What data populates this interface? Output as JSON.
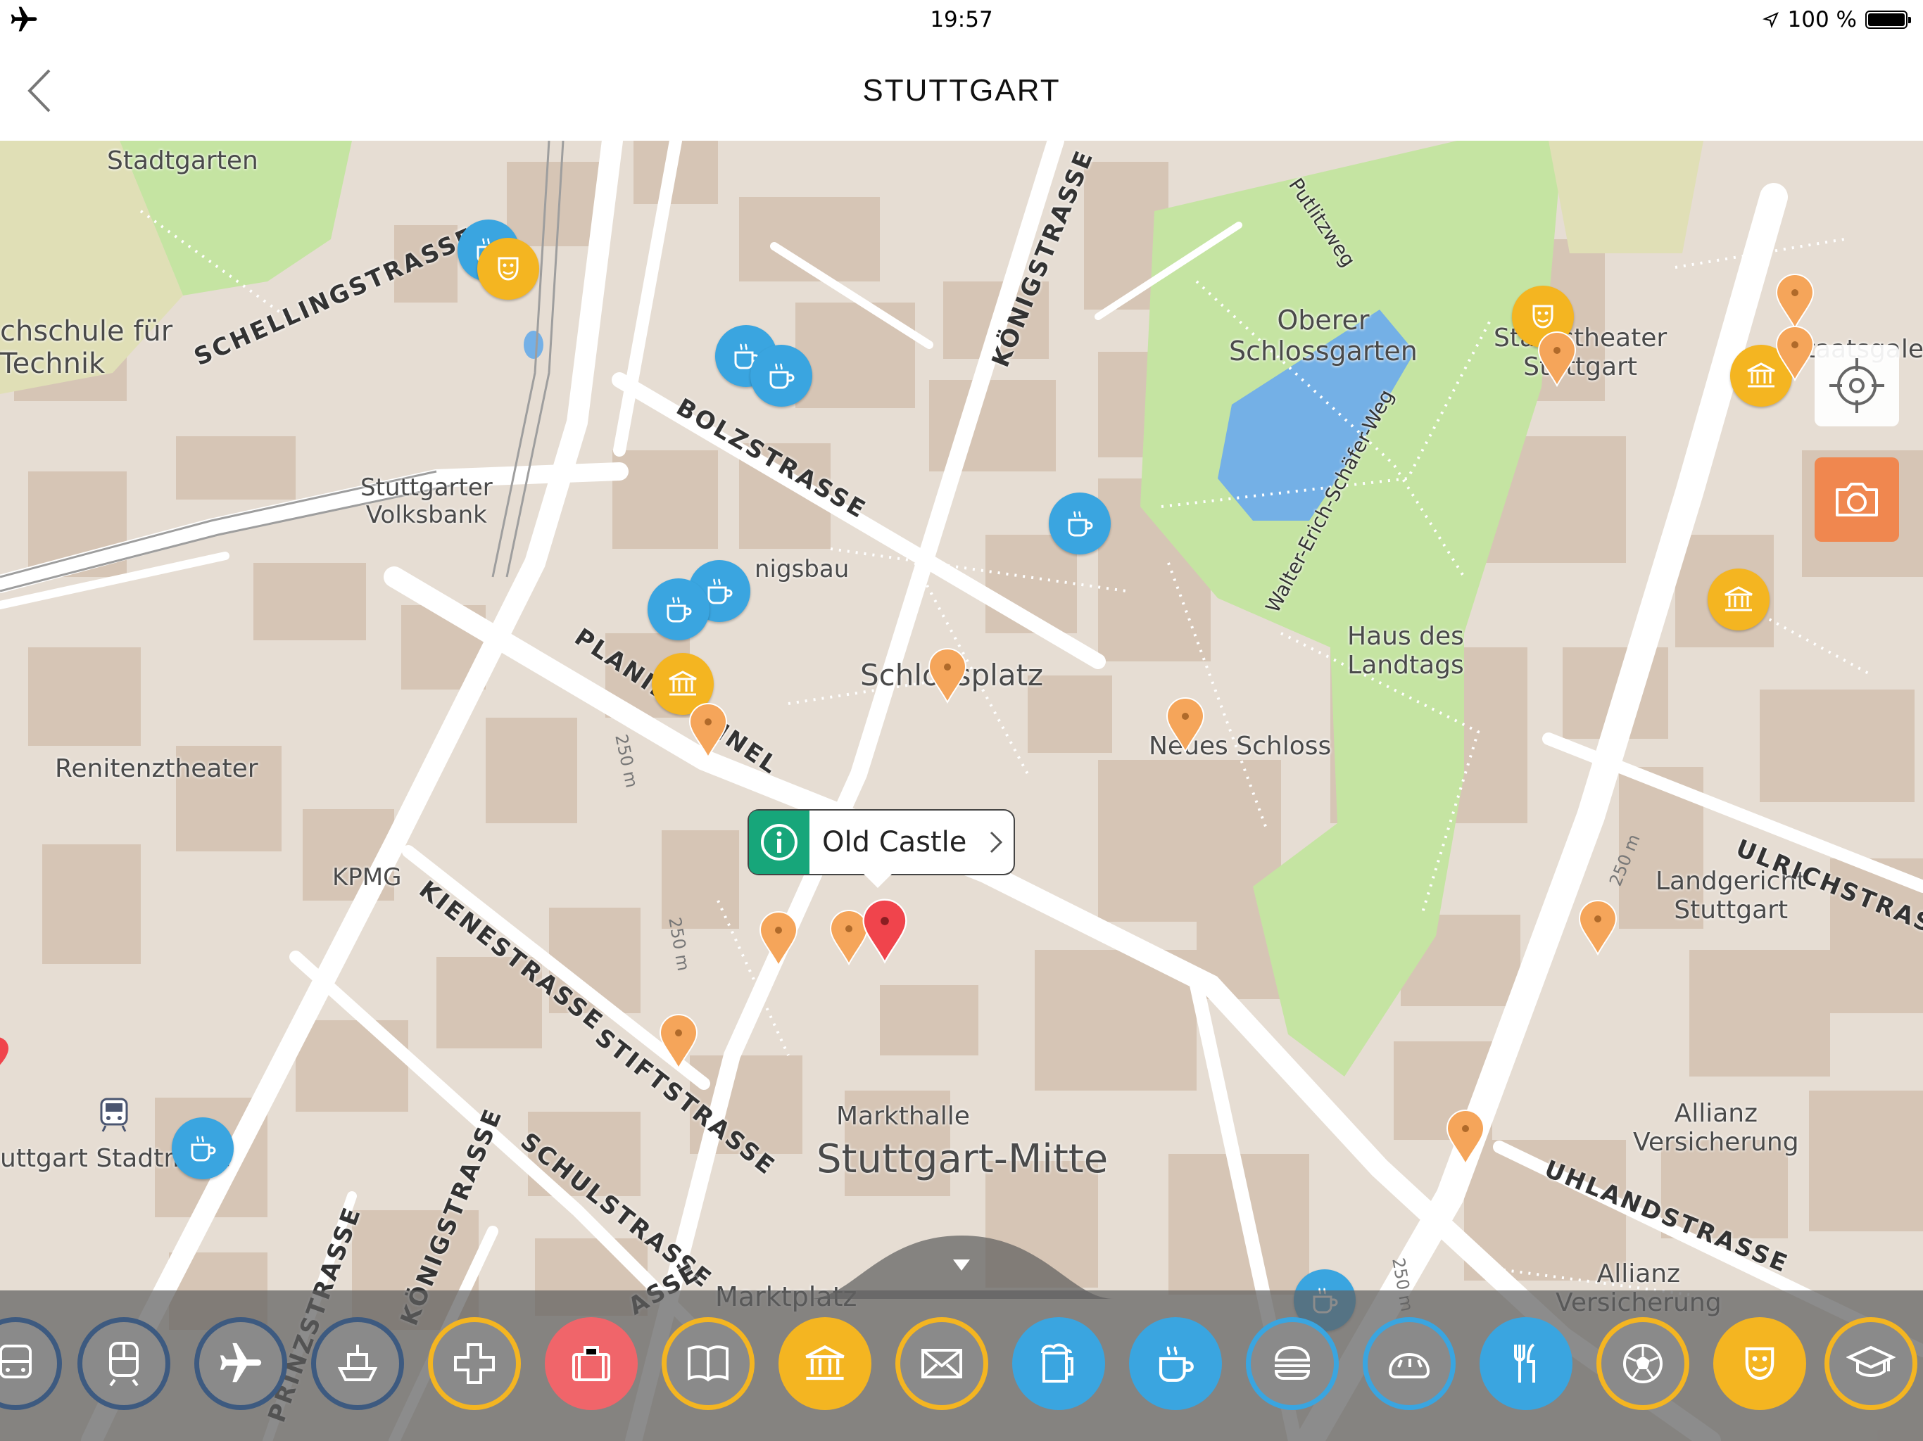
{
  "status_bar": {
    "time": "19:57",
    "battery": "100 %",
    "battery_level": 1.0
  },
  "nav": {
    "title": "STUTTGART"
  },
  "map": {
    "place_labels": [
      {
        "id": "stadtgarten",
        "text": "Stadtgarten"
      },
      {
        "id": "hochschule",
        "text": "chschule für\nTechnik"
      },
      {
        "id": "volksbank",
        "text": "Stuttgarter\nVolksbank"
      },
      {
        "id": "konigsbau",
        "text": "nigsbau"
      },
      {
        "id": "schlossplatz",
        "text": "Schlossplatz"
      },
      {
        "id": "oberer",
        "text": "Oberer\nSchlossgarten"
      },
      {
        "id": "staatstheater",
        "text": "Staatstheater\nStuttgart"
      },
      {
        "id": "staatsgalerie",
        "text": "Staatsgaleri"
      },
      {
        "id": "haus",
        "text": "Haus des\nLandtags"
      },
      {
        "id": "neues",
        "text": "Neues Schloss"
      },
      {
        "id": "renitenz",
        "text": "Renitenztheater"
      },
      {
        "id": "kpmg",
        "text": "KPMG"
      },
      {
        "id": "landgericht",
        "text": "Landgericht\nStuttgart"
      },
      {
        "id": "markthalle",
        "text": "Markthalle"
      },
      {
        "id": "mitte",
        "text": "Stuttgart-Mitte"
      },
      {
        "id": "allianz1",
        "text": "Allianz\nVersicherung"
      },
      {
        "id": "allianz2",
        "text": "Allianz\nVersicherung"
      },
      {
        "id": "marktplatz",
        "text": "Marktplatz"
      },
      {
        "id": "stadtmitte",
        "text": "uttgart Stadtmitte"
      }
    ],
    "street_labels": [
      {
        "id": "schelling",
        "text": "SCHELLINGSTRASSE"
      },
      {
        "id": "konig1",
        "text": "KÖNIGSTRASSE"
      },
      {
        "id": "bolz",
        "text": "BOLZSTRASSE"
      },
      {
        "id": "planie",
        "text": "PLANIE TUNNEL"
      },
      {
        "id": "kiene",
        "text": "KIENESTRASSE"
      },
      {
        "id": "stift",
        "text": "STIFTSTRASSE"
      },
      {
        "id": "schul",
        "text": "SCHULSTRASSE"
      },
      {
        "id": "konig2",
        "text": "KÖNIGSTRASSE"
      },
      {
        "id": "prinz",
        "text": "PRINZSTRASSE"
      },
      {
        "id": "ulrich",
        "text": "ULRICHSTRASSE"
      },
      {
        "id": "uhland",
        "text": "UHLANDSTRASSE"
      },
      {
        "id": "putlitz",
        "text": "Putlitzweg"
      },
      {
        "id": "walter",
        "text": "Walter-Erich-Schäfer-Weg"
      },
      {
        "id": "strasse_bottom",
        "text": "ASSE"
      }
    ],
    "distance_labels": [
      "250 m",
      "250 m",
      "250 m",
      "250 m"
    ],
    "callout": {
      "label": "Old Castle"
    }
  },
  "categories": [
    {
      "id": "bus",
      "icon": "bus-icon",
      "color": "#3d5a80"
    },
    {
      "id": "train",
      "icon": "train-icon",
      "color": "#3d5a80"
    },
    {
      "id": "airport",
      "icon": "airplane-icon",
      "color": "#3d5a80"
    },
    {
      "id": "ship",
      "icon": "ship-icon",
      "color": "#3d5a80"
    },
    {
      "id": "health",
      "icon": "plus-icon",
      "color": "#f4b521"
    },
    {
      "id": "luggage",
      "icon": "luggage-icon",
      "color": "#f0656a"
    },
    {
      "id": "library",
      "icon": "book-icon",
      "color": "#f4b521"
    },
    {
      "id": "museum",
      "icon": "museum-icon",
      "color": "#f4b521"
    },
    {
      "id": "post",
      "icon": "mail-icon",
      "color": "#f4b521"
    },
    {
      "id": "beer",
      "icon": "beer-icon",
      "color": "#3aa5e0"
    },
    {
      "id": "cafe",
      "icon": "coffee-icon",
      "color": "#3aa5e0"
    },
    {
      "id": "fastfood",
      "icon": "burger-icon",
      "color": "#3aa5e0"
    },
    {
      "id": "bakery",
      "icon": "bread-icon",
      "color": "#3aa5e0"
    },
    {
      "id": "restaurant",
      "icon": "cutlery-icon",
      "color": "#3aa5e0"
    },
    {
      "id": "sports",
      "icon": "soccer-icon",
      "color": "#f4b521"
    },
    {
      "id": "theater",
      "icon": "theater-mask-icon",
      "color": "#f4b521"
    },
    {
      "id": "education",
      "icon": "graduation-cap-icon",
      "color": "#f4b521"
    }
  ],
  "colors": {
    "cafe": "#3aa5e0",
    "culture": "#f4b521",
    "sight": "#f5a55a",
    "selected": "#f0444c",
    "park": "#c5e4a2",
    "water": "#74b0e6",
    "building": "#d6c5b5",
    "info": "#17a67a"
  }
}
